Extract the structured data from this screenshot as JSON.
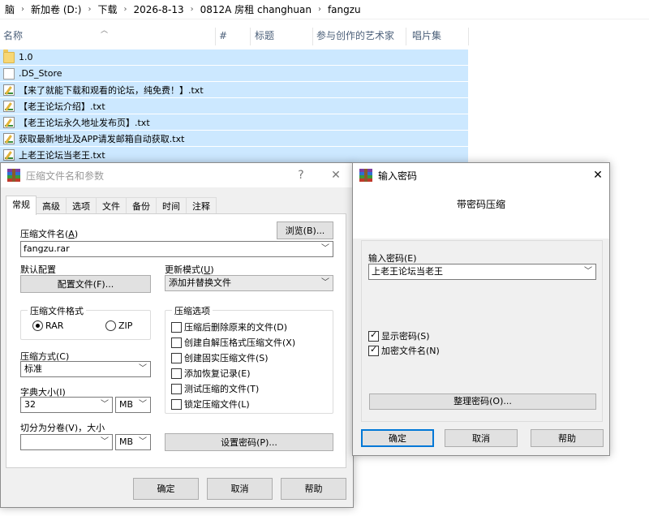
{
  "explorer": {
    "breadcrumb": [
      "脑",
      "新加卷 (D:)",
      "下载",
      "2026-8-13",
      "0812A 房租 changhuan",
      "fangzu"
    ],
    "columns": {
      "name": "名称",
      "number": "#",
      "title": "标题",
      "artist": "参与创作的艺术家",
      "album": "唱片集"
    },
    "files": [
      {
        "name": "1.0",
        "icon": "folder-icon"
      },
      {
        "name": ".DS_Store",
        "icon": "file-icon"
      },
      {
        "name": "【来了就能下载和观看的论坛，纯免费！】.txt",
        "icon": "text-file-icon"
      },
      {
        "name": "【老王论坛介绍】.txt",
        "icon": "text-file-icon"
      },
      {
        "name": "【老王论坛永久地址发布页】.txt",
        "icon": "text-file-icon"
      },
      {
        "name": "获取最新地址及APP请发邮箱自动获取.txt",
        "icon": "text-file-icon"
      },
      {
        "name": "上老王论坛当老王.txt",
        "icon": "text-file-icon"
      }
    ],
    "selection_color": "#cce8ff"
  },
  "archive_dialog": {
    "title": "压缩文件名和参数",
    "help_glyph": "?",
    "close_glyph": "✕",
    "tabs": [
      "常规",
      "高级",
      "选项",
      "文件",
      "备份",
      "时间",
      "注释"
    ],
    "archive_name_label": "压缩文件名(",
    "archive_name_key": "A",
    "archive_name_label_end": ")",
    "browse_button": "浏览(B)...",
    "archive_name_value": "fangzu.rar",
    "profile_label": "默认配置",
    "profile_button": "配置文件(F)...",
    "update_mode_label": "更新模式(",
    "update_mode_key": "U",
    "update_mode_label_end": ")",
    "update_mode_value": "添加并替换文件",
    "format_group": "压缩文件格式",
    "format_rar": "RAR",
    "format_zip": "ZIP",
    "format_selected": "RAR",
    "options_group": "压缩选项",
    "options": [
      {
        "label": "压缩后删除原来的文件(D)",
        "checked": false
      },
      {
        "label": "创建自解压格式压缩文件(X)",
        "checked": false
      },
      {
        "label": "创建固实压缩文件(S)",
        "checked": false
      },
      {
        "label": "添加恢复记录(E)",
        "checked": false
      },
      {
        "label": "测试压缩的文件(T)",
        "checked": false
      },
      {
        "label": "锁定压缩文件(L)",
        "checked": false
      }
    ],
    "method_label": "压缩方式(C)",
    "method_value": "标准",
    "dict_label": "字典大小(I)",
    "dict_value": "32",
    "dict_unit": "MB",
    "split_label": "切分为分卷(V)，大小",
    "split_value": "",
    "split_unit": "MB",
    "set_password_button": "设置密码(P)...",
    "ok": "确定",
    "cancel": "取消",
    "help": "帮助"
  },
  "password_dialog": {
    "title": "输入密码",
    "close_glyph": "✕",
    "header": "带密码压缩",
    "password_label": "输入密码(E)",
    "password_value": "上老王论坛当老王",
    "show_password": "显示密码(S)",
    "show_password_checked": true,
    "encrypt_names": "加密文件名(N)",
    "encrypt_names_checked": true,
    "organize_button": "整理密码(O)...",
    "ok": "确定",
    "cancel": "取消",
    "help": "帮助",
    "accent": "#0078d7"
  }
}
